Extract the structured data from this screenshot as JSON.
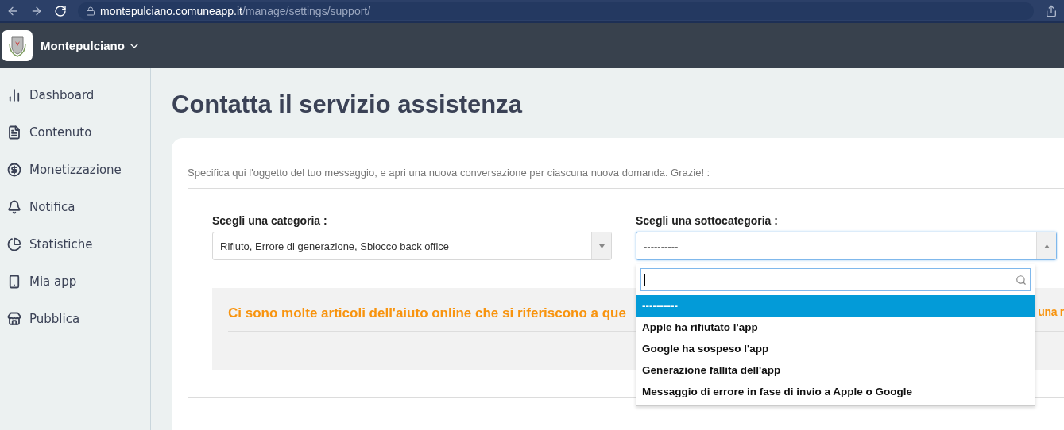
{
  "browser": {
    "url_host": "montepulciano.comuneapp.it",
    "url_path": "/manage/settings/support/"
  },
  "navbar": {
    "app_name": "Montepulciano"
  },
  "sidebar": {
    "items": [
      {
        "kind": "chart",
        "label": "Dashboard"
      },
      {
        "kind": "file",
        "label": "Contenuto"
      },
      {
        "kind": "dollar",
        "label": "Monetizzazione"
      },
      {
        "kind": "bell",
        "label": "Notifica"
      },
      {
        "kind": "pie",
        "label": "Statistiche"
      },
      {
        "kind": "phone",
        "label": "Mia app"
      },
      {
        "kind": "store",
        "label": "Pubblica"
      }
    ]
  },
  "page": {
    "title": "Contatta il servizio assistenza",
    "intro": "Specifica qui l'oggetto del tuo messaggio, e apri una nuova conversazione per ciascuna nuova domanda. Grazie! :",
    "category": {
      "label": "Scegli una categoria :",
      "value": "Rifiuto, Errore di generazione, Sblocco back office"
    },
    "subcategory": {
      "label": "Scegli una sottocategoria :",
      "value": "----------",
      "expanded": true,
      "options": [
        {
          "label": "----------",
          "selected": true
        },
        {
          "label": "Apple ha rifiutato l'app",
          "selected": false
        },
        {
          "label": "Google ha sospeso l'app",
          "selected": false
        },
        {
          "label": "Generazione fallita dell'app",
          "selected": false
        },
        {
          "label": "Messaggio di errore in fase di invio a Apple o Google",
          "selected": false
        }
      ]
    },
    "notice": {
      "text_left": "Ci sono molte articoli dell'aiuto online che si riferiscono a que",
      "text_right": "una r"
    }
  }
}
